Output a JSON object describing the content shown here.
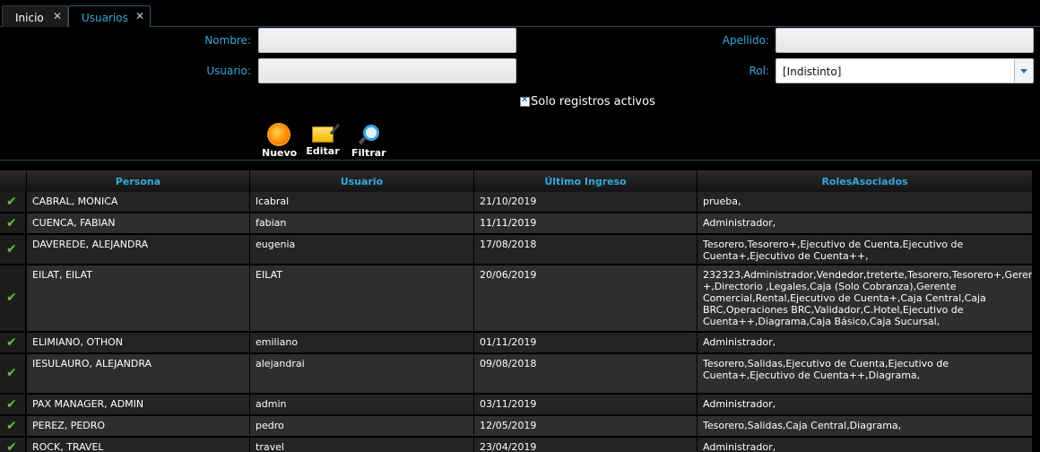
{
  "tabs": [
    {
      "label": "Inicio",
      "close": "✕"
    },
    {
      "label": "Usuarios",
      "close": "✕"
    }
  ],
  "filters": {
    "nombre_label": "Nombre:",
    "nombre_value": "",
    "apellido_label": "Apellido:",
    "apellido_value": "",
    "usuario_label": "Usuario:",
    "usuario_value": "",
    "rol_label": "Rol:",
    "rol_value": "[Indistinto]",
    "solo_activos_label": "Solo registros activos",
    "solo_activos_checked": true
  },
  "toolbar": {
    "nuevo": "Nuevo",
    "editar": "Editar",
    "filtrar": "Filtrar"
  },
  "colors": {
    "accent": "#35a8d8",
    "check": "#5fc431"
  },
  "table": {
    "columns": [
      "Persona",
      "Usuario",
      "Último Ingreso",
      "RolesAsociados"
    ],
    "rows": [
      {
        "persona": "CABRAL, MONICA",
        "usuario": "lcabral",
        "ingreso": "21/10/2019",
        "roles": "prueba,"
      },
      {
        "persona": "CUENCA, FABIAN",
        "usuario": "fabian",
        "ingreso": "11/11/2019",
        "roles": "Administrador,"
      },
      {
        "persona": "DAVEREDE, ALEJANDRA",
        "usuario": "eugenia",
        "ingreso": "17/08/2018",
        "roles": "Tesorero,Tesorero+,Ejecutivo de Cuenta,Ejecutivo de Cuenta+,Ejecutivo de Cuenta++,"
      },
      {
        "persona": "EILAT, EILAT",
        "usuario": "EILAT",
        "ingreso": "20/06/2019",
        "roles": "232323,Administrador,Vendedor,treterte,Tesorero,Tesorero+,Gerente +,Directorio ,Legales,Caja (Solo Cobranza),Gerente Comercial,Rental,Ejecutivo de Cuenta+,Caja Central,Caja BRC,Operaciones BRC,Validador,C.Hotel,Ejecutivo de Cuenta++,Diagrama,Caja Básico,Caja Sucursal,"
      },
      {
        "persona": "ELIMIANO, OTHON",
        "usuario": "emiliano",
        "ingreso": "01/11/2019",
        "roles": "Administrador,"
      },
      {
        "persona": "IESULAURO, ALEJANDRA",
        "usuario": "alejandrai",
        "ingreso": "09/08/2018",
        "roles": "Tesorero,Salidas,Ejecutivo de Cuenta,Ejecutivo de Cuenta+,Ejecutivo de Cuenta++,Diagrama,"
      },
      {
        "persona": "PAX MANAGER, ADMIN",
        "usuario": "admin",
        "ingreso": "03/11/2019",
        "roles": "Administrador,"
      },
      {
        "persona": "PEREZ, PEDRO",
        "usuario": "pedro",
        "ingreso": "12/05/2019",
        "roles": "Tesorero,Salidas,Caja Central,Diagrama,"
      },
      {
        "persona": "ROCK, TRAVEL",
        "usuario": "travel",
        "ingreso": "23/04/2019",
        "roles": "Administrador,"
      }
    ]
  }
}
